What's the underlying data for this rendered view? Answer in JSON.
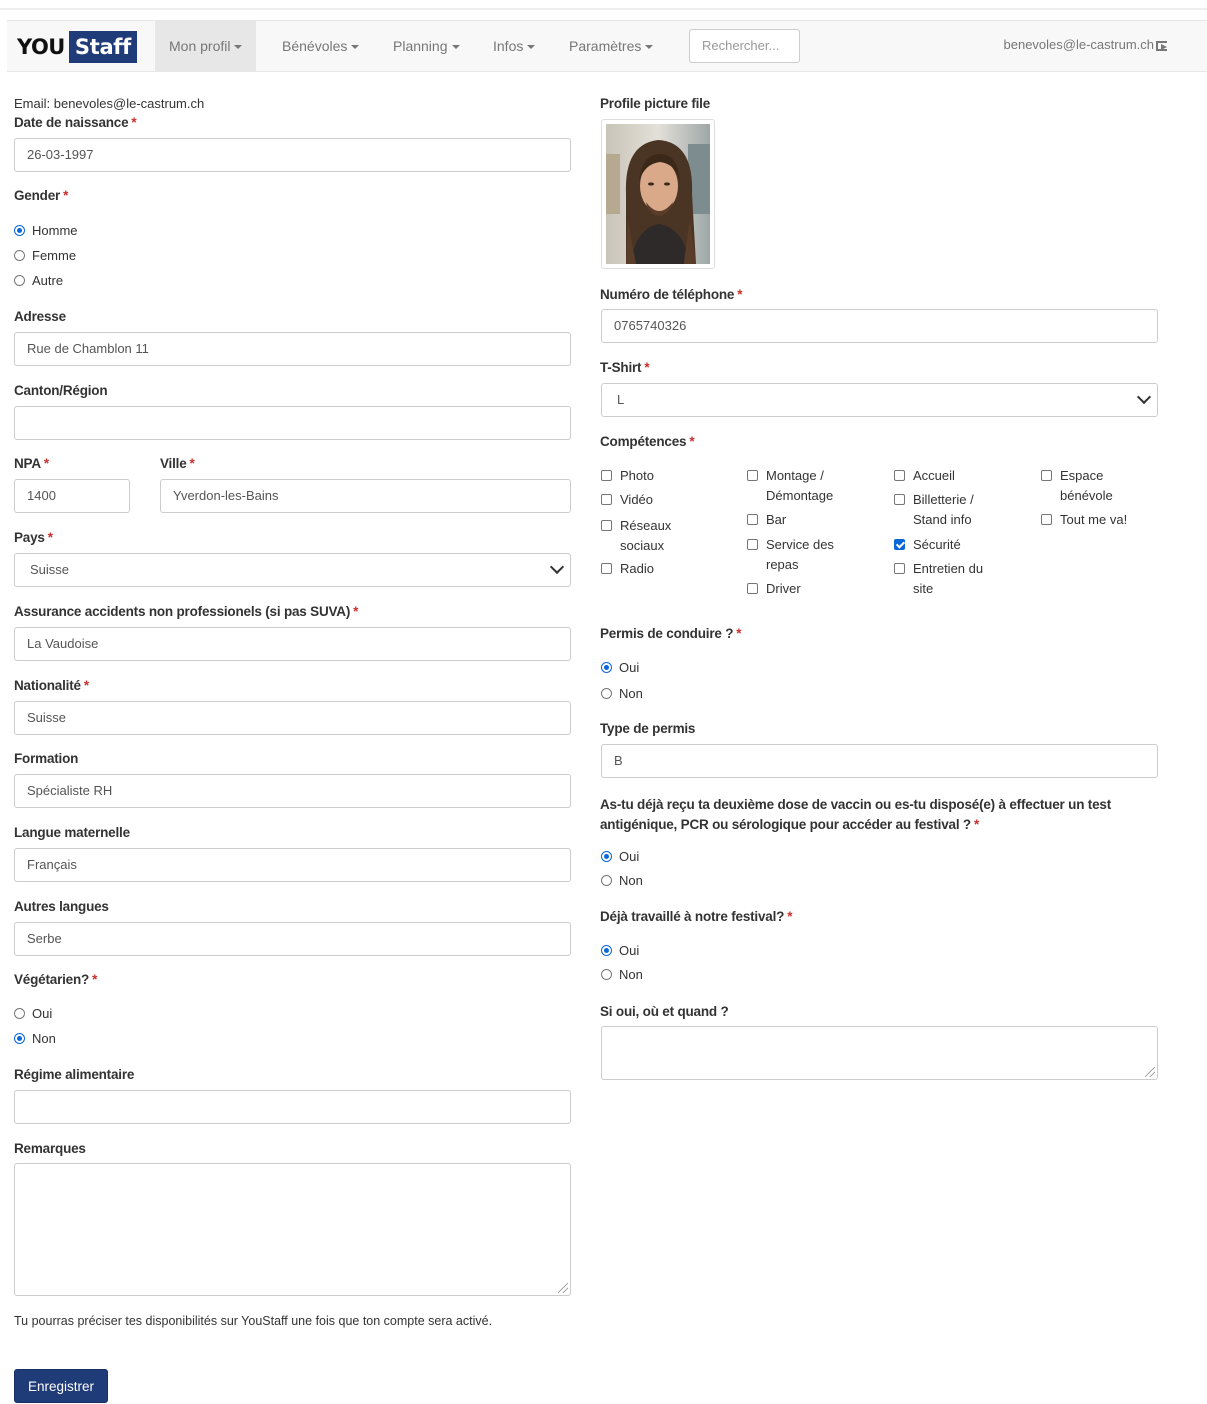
{
  "nav": {
    "brand_you": "YOU",
    "brand_staff": "Staff",
    "items": [
      "Mon profil",
      "Bénévoles",
      "Planning",
      "Infos",
      "Paramètres"
    ],
    "search_placeholder": "Rechercher...",
    "user_email": "benevoles@le-castrum.ch"
  },
  "left": {
    "email_line": "Email: benevoles@le-castrum.ch",
    "dob_label": "Date de naissance",
    "dob_value": "26-03-1997",
    "gender_label": "Gender",
    "gender_options": [
      "Homme",
      "Femme",
      "Autre"
    ],
    "gender_selected": "Homme",
    "address_label": "Adresse",
    "address_value": "Rue de Chamblon 11",
    "canton_label": "Canton/Région",
    "canton_value": "",
    "npa_label": "NPA",
    "npa_value": "1400",
    "city_label": "Ville",
    "city_value": "Yverdon-les-Bains",
    "country_label": "Pays",
    "country_value": "Suisse",
    "insurance_label": "Assurance accidents non professionels (si pas SUVA)",
    "insurance_value": "La Vaudoise",
    "nationality_label": "Nationalité",
    "nationality_value": "Suisse",
    "training_label": "Formation",
    "training_value": "Spécialiste RH",
    "mother_tongue_label": "Langue maternelle",
    "mother_tongue_value": "Français",
    "other_languages_label": "Autres langues",
    "other_languages_value": "Serbe",
    "vegetarian_label": "Végétarien?",
    "vegetarian_options": [
      "Oui",
      "Non"
    ],
    "vegetarian_selected": "Non",
    "diet_label": "Régime alimentaire",
    "diet_value": "",
    "remarks_label": "Remarques",
    "info_text": "Tu pourras préciser tes disponibilités sur YouStaff une fois que ton compte sera activé.",
    "save_label": "Enregistrer"
  },
  "right": {
    "photo_label": "Profile picture file",
    "phone_label": "Numéro de téléphone",
    "phone_value": "0765740326",
    "tshirt_label": "T-Shirt",
    "tshirt_value": "L",
    "skills_label": "Compétences",
    "skills": [
      {
        "label": "Photo",
        "checked": false
      },
      {
        "label": "Vidéo",
        "checked": false
      },
      {
        "label": "Réseaux sociaux",
        "checked": false
      },
      {
        "label": "Radio",
        "checked": false
      },
      {
        "label": "Montage / Démontage",
        "checked": false
      },
      {
        "label": "Bar",
        "checked": false
      },
      {
        "label": "Service des repas",
        "checked": false
      },
      {
        "label": "Driver",
        "checked": false
      },
      {
        "label": "Accueil",
        "checked": false
      },
      {
        "label": "Billetterie / Stand info",
        "checked": false
      },
      {
        "label": "Sécurité",
        "checked": true
      },
      {
        "label": "Entretien du site",
        "checked": false
      },
      {
        "label": "Espace bénévole",
        "checked": false
      },
      {
        "label": "Tout me va!",
        "checked": false
      }
    ],
    "license_label": "Permis de conduire ?",
    "license_options": [
      "Oui",
      "Non"
    ],
    "license_selected": "Oui",
    "license_type_label": "Type de permis",
    "license_type_value": "B",
    "vaccine_label": "As-tu déjà reçu ta deuxième dose de vaccin ou es-tu disposé(e) à effectuer un test antigénique, PCR ou sérologique pour accéder au festival ?",
    "vaccine_options": [
      "Oui",
      "Non"
    ],
    "vaccine_selected": "Oui",
    "worked_label": "Déjà travaillé à notre festival?",
    "worked_options": [
      "Oui",
      "Non"
    ],
    "worked_selected": "Oui",
    "where_when_label": "Si oui, où et quand ?"
  },
  "colors": {
    "brand": "#1f3b78",
    "required": "#c9302c",
    "radio_accent": "#0b67d8"
  }
}
